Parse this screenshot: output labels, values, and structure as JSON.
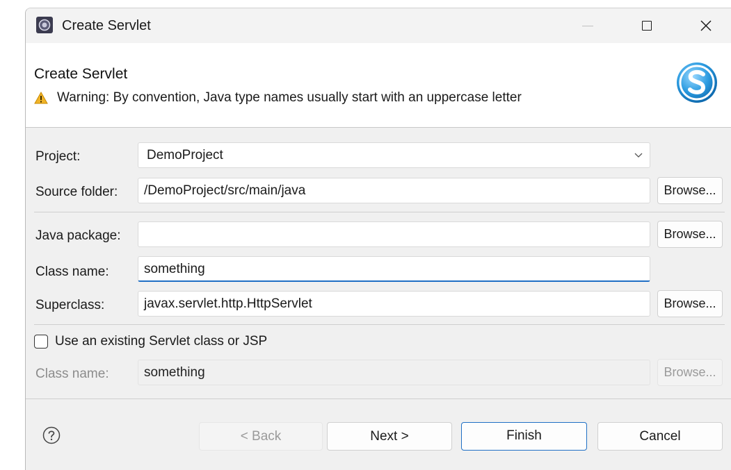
{
  "window": {
    "title": "Create Servlet"
  },
  "banner": {
    "title": "Create Servlet",
    "warning": "Warning: By convention, Java type names usually start with an uppercase letter"
  },
  "form": {
    "project_label": "Project:",
    "project_value": "DemoProject",
    "source_folder_label": "Source folder:",
    "source_folder_value": "/DemoProject/src/main/java",
    "java_package_label": "Java package:",
    "java_package_value": "",
    "class_name_label": "Class name:",
    "class_name_value": "something",
    "superclass_label": "Superclass:",
    "superclass_value": "javax.servlet.http.HttpServlet",
    "browse_label": "Browse...",
    "use_existing_label": "Use an existing Servlet class or JSP",
    "use_existing_checked": false,
    "existing_class_label": "Class name:",
    "existing_class_value": "something"
  },
  "footer": {
    "back": "< Back",
    "next": "Next >",
    "finish": "Finish",
    "cancel": "Cancel"
  },
  "colors": {
    "accent": "#1f6fc5",
    "warning": "#f0b429"
  },
  "icons": [
    "eclipse-app-icon",
    "minimize-icon",
    "maximize-icon",
    "close-icon",
    "warning-icon",
    "servlet-logo-icon",
    "chevron-down-icon",
    "help-icon"
  ]
}
